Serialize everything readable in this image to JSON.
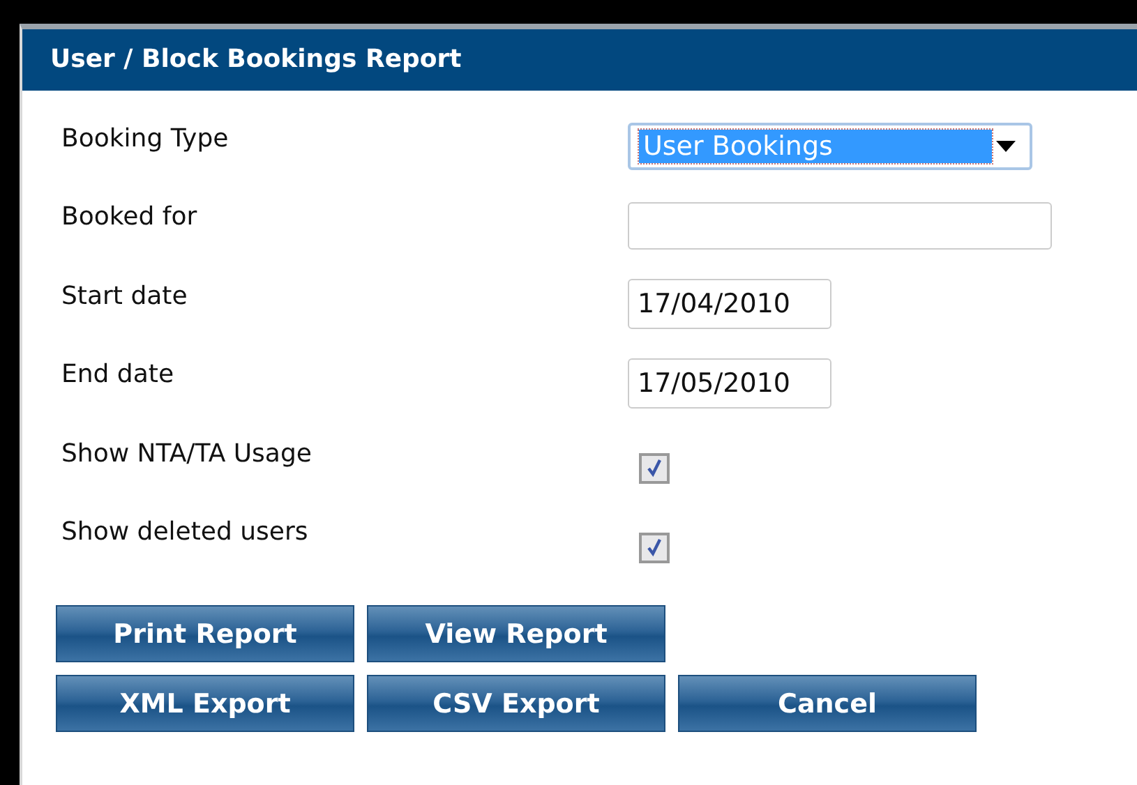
{
  "window": {
    "title": "User / Block Bookings Report"
  },
  "fields": [
    {
      "label": "Booking Type",
      "kind": "select",
      "value": "User Bookings"
    },
    {
      "label": "Booked for",
      "kind": "text"
    },
    {
      "label": "Start date",
      "kind": "date",
      "value": "17/04/2010"
    },
    {
      "label": "End date",
      "kind": "date",
      "value": "17/05/2010"
    },
    {
      "label": "Show NTA/TA Usage",
      "kind": "checkbox",
      "checked": true
    },
    {
      "label": "Show deleted users",
      "kind": "checkbox",
      "checked": true
    }
  ],
  "button_rows": [
    [
      "Print Report",
      "View Report"
    ],
    [
      "XML Export",
      "CSV Export",
      "Cancel"
    ]
  ]
}
